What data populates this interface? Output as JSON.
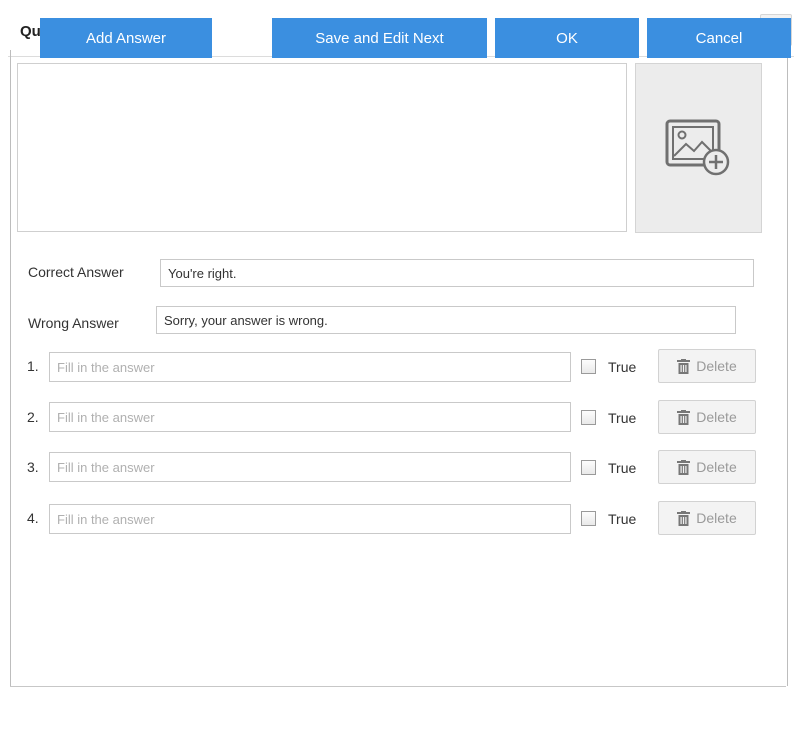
{
  "dialog": {
    "title": "Question Editor",
    "close_label": "×"
  },
  "question": {
    "text": "",
    "image_upload_icon": "image-add-icon"
  },
  "feedback": {
    "correct_label": "Correct Answer",
    "correct_value": "You're right.",
    "wrong_label": "Wrong Answer",
    "wrong_value": "Sorry, your answer is wrong."
  },
  "answers": [
    {
      "number": "1.",
      "placeholder": "Fill in the answer",
      "value": "",
      "true_label": "True",
      "checked": false,
      "delete_label": "Delete"
    },
    {
      "number": "2.",
      "placeholder": "Fill in the answer",
      "value": "",
      "true_label": "True",
      "checked": false,
      "delete_label": "Delete"
    },
    {
      "number": "3.",
      "placeholder": "Fill in the answer",
      "value": "",
      "true_label": "True",
      "checked": false,
      "delete_label": "Delete"
    },
    {
      "number": "4.",
      "placeholder": "Fill in the answer",
      "value": "",
      "true_label": "True",
      "checked": false,
      "delete_label": "Delete"
    }
  ],
  "footer": {
    "add_answer": "Add Answer",
    "save_next": "Save and Edit Next",
    "ok": "OK",
    "cancel": "Cancel"
  },
  "colors": {
    "primary_button": "#3b8fe0",
    "placeholder_text": "#b0b0b0",
    "disabled_button_text": "#9a9a9a"
  }
}
